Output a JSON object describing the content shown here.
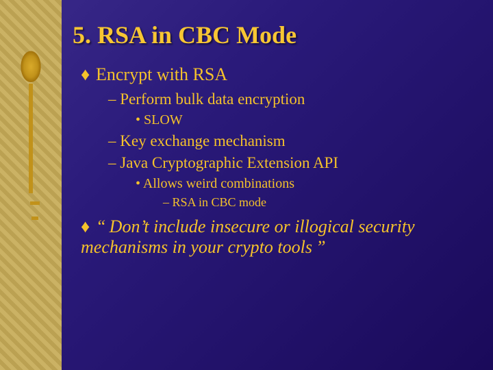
{
  "title": "5. RSA in CBC Mode",
  "bullets": {
    "b1": "Encrypt with RSA",
    "b1a": "Perform bulk data encryption",
    "b1a1": "SLOW",
    "b1b": "Key exchange mechanism",
    "b1c": "Java Cryptographic Extension API",
    "b1c1": "Allows weird combinations",
    "b1c1a": "RSA in CBC mode",
    "b2": "“ Don’t include insecure or illogical security mechanisms in your crypto tools ”"
  },
  "glyphs": {
    "diamond": "♦"
  }
}
